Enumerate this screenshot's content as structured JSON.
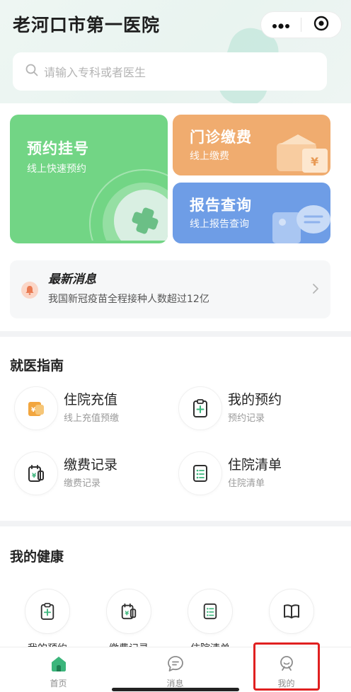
{
  "header": {
    "title": "老河口市第一医院",
    "search_placeholder": "请输入专科或者医生"
  },
  "cards": {
    "booking": {
      "title": "预约挂号",
      "subtitle": "线上快速预约"
    },
    "payment": {
      "title": "门诊缴费",
      "subtitle": "线上缴费"
    },
    "report": {
      "title": "报告查询",
      "subtitle": "线上报告查询"
    }
  },
  "news": {
    "title": "最新消息",
    "text": "我国新冠疫苗全程接种人数超过12亿"
  },
  "guide": {
    "title": "就医指南",
    "items": [
      {
        "label": "住院充值",
        "sub": "线上充值预缴",
        "icon": "wallet-icon"
      },
      {
        "label": "我的预约",
        "sub": "预约记录",
        "icon": "clipboard-plus-icon"
      },
      {
        "label": "缴费记录",
        "sub": "缴费记录",
        "icon": "bill-icon"
      },
      {
        "label": "住院清单",
        "sub": "住院清单",
        "icon": "list-icon"
      }
    ]
  },
  "health": {
    "title": "我的健康",
    "items": [
      {
        "label": "我的预约",
        "icon": "clipboard-plus-icon"
      },
      {
        "label": "缴费记录",
        "icon": "bill-icon"
      },
      {
        "label": "住院清单",
        "icon": "list-icon"
      },
      {
        "label": "",
        "icon": "book-icon"
      }
    ]
  },
  "tabbar": {
    "items": [
      {
        "label": "首页",
        "icon": "home-icon"
      },
      {
        "label": "消息",
        "icon": "message-icon"
      },
      {
        "label": "我的",
        "icon": "profile-icon"
      }
    ],
    "active_index": 0
  },
  "colors": {
    "brand_green": "#3bb57b",
    "booking_card": "#72d585",
    "payment_card": "#f0ac6f",
    "report_card": "#6e9de6",
    "highlight": "#e02020"
  }
}
